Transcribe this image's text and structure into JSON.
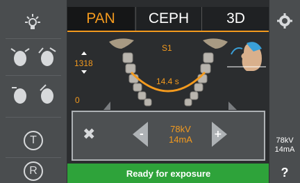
{
  "tabs": [
    {
      "label": "PAN",
      "active": true
    },
    {
      "label": "CEPH",
      "active": false
    },
    {
      "label": "3D",
      "active": false
    }
  ],
  "program": {
    "name": "S1",
    "height_value": "1318",
    "lower_value": "0",
    "duration": "14.4 s"
  },
  "exposure": {
    "kv": "78kV",
    "ma": "14mA",
    "minus_label": "-",
    "plus_label": "+"
  },
  "status": {
    "ready_text": "Ready for exposure"
  },
  "right_panel": {
    "kv": "78kV",
    "ma": "14mA",
    "help": "?"
  },
  "left_panel": {
    "mode_t": "T",
    "mode_r": "R"
  },
  "colors": {
    "accent": "#f39a1e",
    "ready": "#2ea33a"
  },
  "icons": [
    "light-icon",
    "head-tilt-icon",
    "head-rotate-icon",
    "settings-icon",
    "patient-head-icon",
    "cancel-icon"
  ]
}
